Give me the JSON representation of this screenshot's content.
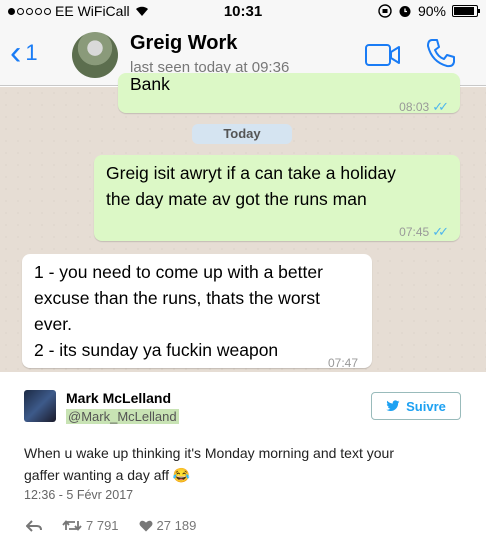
{
  "statusbar": {
    "carrier": "EE WiFiCall",
    "time": "10:31",
    "battery": "90%",
    "battery_level": 0.9
  },
  "chat_header": {
    "back_count": "1",
    "contact_name": "Greig Work",
    "last_seen": "last seen today at 09:36"
  },
  "messages": [
    {
      "direction": "outgoing",
      "text": "Bank",
      "time": "08:03"
    },
    {
      "direction": "outgoing",
      "lines": [
        "Greig isit awryt if a can take a holiday",
        "the day mate av got the runs man"
      ],
      "time": "07:45"
    },
    {
      "direction": "incoming",
      "lines": [
        "1 - you need to come up with a better",
        "excuse than the runs, thats the worst",
        "ever.",
        "2 - its sunday ya fuckin weapon"
      ],
      "time": "07:47"
    }
  ],
  "date_separator": "Today",
  "tweet": {
    "name": "Mark McLelland",
    "handle": "@Mark_McLelland",
    "follow_label": "Suivre",
    "text_lines": [
      "When u wake up thinking it's Monday morning and text your",
      "gaffer wanting a day aff 😂"
    ],
    "date": "12:36 - 5 Févr 2017",
    "retweets": "7 791",
    "likes": "27 189"
  },
  "colors": {
    "ios_blue": "#1a7cf5",
    "outgoing_bubble": "#dcf8c6",
    "chat_background": "#e6ddd4",
    "read_ticks": "#4fb6ec",
    "twitter_blue": "#1da1f2"
  }
}
